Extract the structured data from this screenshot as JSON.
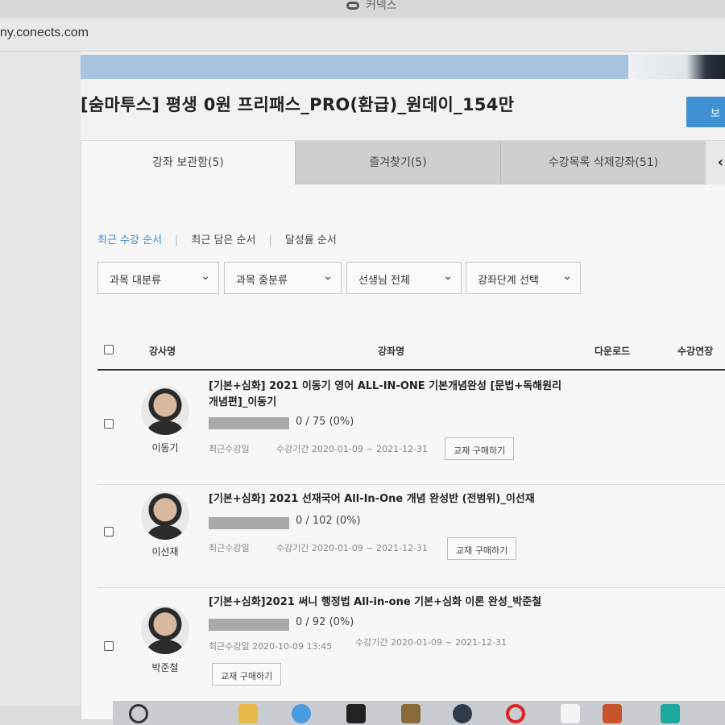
{
  "browser": {
    "tab_title": "커넥스",
    "url": "ny.conects.com"
  },
  "page": {
    "course_title": "[숨마투스] 평생 0원 프리패스_PRO(환급)_원데이_154만",
    "top_button_label": "보"
  },
  "tabs": [
    {
      "label": "강좌 보관함(5)"
    },
    {
      "label": "즐겨찾기(5)"
    },
    {
      "label": "수강목록 삭제강좌(51)"
    }
  ],
  "tab_nav_icon": "chevron-left-icon",
  "sort": {
    "recent_watch": "최근 수강 순서",
    "recent_added": "최근 담은 순서",
    "achievement": "달성률 순서"
  },
  "filters": [
    {
      "label": "과목 대분류"
    },
    {
      "label": "과목 중분류"
    },
    {
      "label": "선생님 전체"
    },
    {
      "label": "강좌단계 선택"
    }
  ],
  "table": {
    "headers": {
      "teacher": "강사명",
      "lecture": "강좌명",
      "download": "다운로드",
      "extension": "수강연장"
    },
    "rows": [
      {
        "teacher": "이동기",
        "title": "[기본+심화] 2021 이동기 영어 ALL-IN-ONE 기본개념완성 [문법+독해원리 개념편]_이동기",
        "progress": "0 / 75 (0%)",
        "progress_fraction": 0,
        "last_watched": "최근수강일",
        "period": "수강기간 2020-01-09 ~ 2021-12-31",
        "buy_label": "교재 구매하기"
      },
      {
        "teacher": "이선재",
        "title": "[기본+심화] 2021 선재국어 All-In-One 개념 완성반 (전범위)_이선재",
        "progress": "0 / 102 (0%)",
        "progress_fraction": 0,
        "last_watched": "최근수강일",
        "period": "수강기간 2020-01-09 ~ 2021-12-31",
        "buy_label": "교재 구매하기"
      },
      {
        "teacher": "박준철",
        "title": "[기본+심화]2021 써니 행정법 All-in-one 기본+심화 이론 완성_박준철",
        "progress": "0 / 92 (0%)",
        "progress_fraction": 0,
        "last_watched": "최근수강일 2020-10-09 13:45",
        "period": "수강기간 2020-01-09 ~ 2021-12-31",
        "buy_label": "교재 구매하기"
      }
    ]
  },
  "colors": {
    "accent_blue": "#3b8ad0",
    "button_blue": "#3f91d3",
    "progress_gray": "#a9a9a9"
  }
}
